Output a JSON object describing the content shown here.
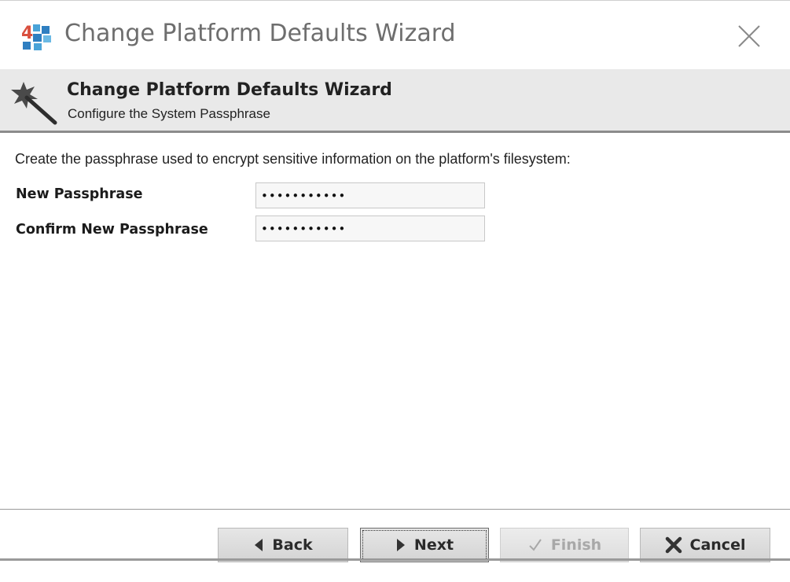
{
  "window": {
    "title": "Change Platform Defaults Wizard"
  },
  "header": {
    "title": "Change Platform Defaults Wizard",
    "subtitle": "Configure the System Passphrase"
  },
  "body": {
    "instruction": "Create the passphrase used to encrypt sensitive information on the platform's filesystem:",
    "fields": [
      {
        "label": "New Passphrase",
        "value": "•••••••••••"
      },
      {
        "label": "Confirm New Passphrase",
        "value": "•••••••••••"
      }
    ]
  },
  "buttons": {
    "back": "Back",
    "next": "Next",
    "finish": "Finish",
    "cancel": "Cancel"
  },
  "icons": {
    "app": "niagara-4-icon",
    "close": "close-icon",
    "wizard": "magic-wand-icon"
  },
  "colors": {
    "header_bg": "#e9e9e9",
    "button_bg": "#dcdcdc",
    "disabled_text": "#a8a8a8",
    "app_icon_red": "#d9503f",
    "app_icon_blue": "#2f7fc1"
  }
}
